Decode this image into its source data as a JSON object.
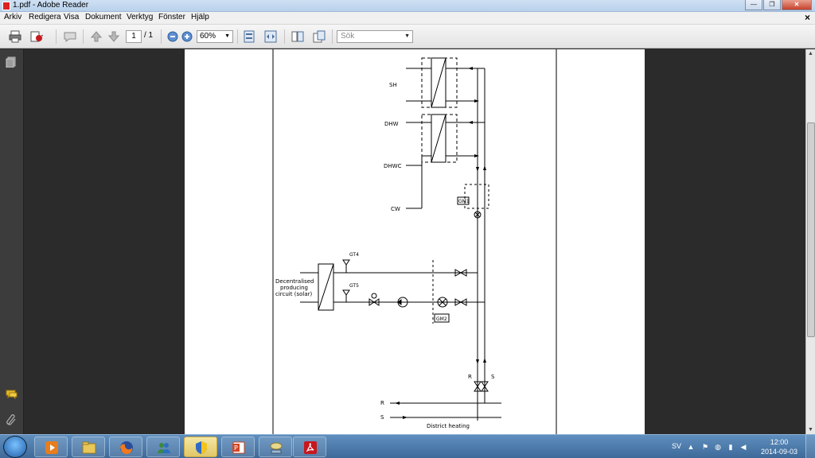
{
  "window": {
    "title": "1.pdf - Adobe Reader",
    "minimize": "—",
    "maximize": "❐",
    "close": "✕"
  },
  "menu": {
    "items": [
      "Arkiv",
      "Redigera",
      "Visa",
      "Dokument",
      "Verktyg",
      "Fönster",
      "Hjälp"
    ],
    "close_doc": "×"
  },
  "toolbar": {
    "page_current": "1",
    "page_total": "/ 1",
    "zoom": "60%",
    "search_placeholder": "Sök"
  },
  "icons": {
    "print": "printer-icon",
    "create": "create-pdf-icon",
    "comment": "comment-icon",
    "prev": "arrow-up-icon",
    "next": "arrow-down-icon",
    "zoom_out": "zoom-out-icon",
    "zoom_in": "zoom-in-icon",
    "fit_page": "fit-page-icon",
    "full": "fit-width-icon",
    "read": "read-mode-icon",
    "share": "share-icon",
    "pages_panel": "pages-icon",
    "comments_panel": "speech-bubble-icon",
    "attachments_panel": "paperclip-icon"
  },
  "diagram": {
    "labels": {
      "sh": "SH",
      "dhw": "DHW",
      "dhwc": "DHWC",
      "cw": "CW",
      "gm1": "GM1",
      "gm2": "GM2",
      "gt4": "GT4",
      "gt5": "GT5",
      "solar_1": "Decentralised",
      "solar_2": "producing",
      "solar_3": "circuit (solar)",
      "r_vert": "R",
      "s_vert": "S",
      "r_main": "R",
      "s_main": "S",
      "district": "District heating"
    }
  },
  "taskbar": {
    "apps": [
      "media-player-icon",
      "file-explorer-icon",
      "firefox-icon",
      "contacts-icon",
      "security-shield-icon",
      "powerpoint-icon",
      "network-drive-icon",
      "adobe-reader-icon"
    ],
    "active_index": 4,
    "language": "SV",
    "time": "12:00",
    "date": "2014-09-03"
  },
  "colors": {
    "titlebar": "#c4d9f1",
    "doc_bg": "#2b2b2b",
    "taskbar": "#4a79aa",
    "reader_red": "#c8171e"
  }
}
